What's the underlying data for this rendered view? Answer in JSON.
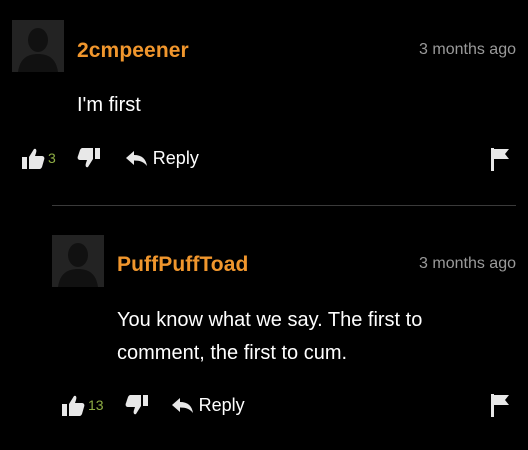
{
  "colors": {
    "username": "#f0962d",
    "like_count": "#8fae45",
    "timestamp": "#9a9a9a",
    "background": "#000000"
  },
  "comments": [
    {
      "username": "2cmpeener",
      "timestamp": "3 months ago",
      "text": "I'm first",
      "likes": "3",
      "reply_label": "Reply",
      "icons": [
        "avatar-placeholder-icon",
        "thumbs-up-icon",
        "thumbs-down-icon",
        "reply-arrow-icon",
        "flag-icon"
      ]
    },
    {
      "username": "PuffPuffToad",
      "timestamp": "3 months ago",
      "text_lines": [
        "You know what we say. The first to",
        "comment, the first to cum."
      ],
      "likes": "13",
      "reply_label": "Reply",
      "icons": [
        "avatar-placeholder-icon",
        "thumbs-up-icon",
        "thumbs-down-icon",
        "reply-arrow-icon",
        "flag-icon"
      ]
    }
  ]
}
